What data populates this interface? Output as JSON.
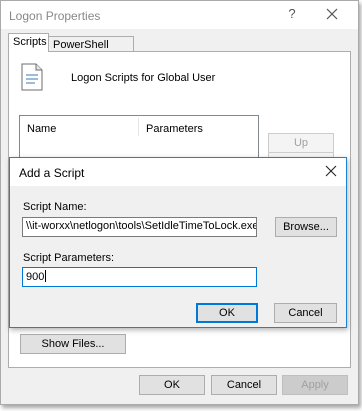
{
  "outer": {
    "title": "Logon Properties",
    "help_glyph": "?",
    "tabs": [
      {
        "label": "Scripts",
        "active": true
      },
      {
        "label": "PowerShell Scripts",
        "active": false
      }
    ],
    "panel_heading": "Logon Scripts for Global User",
    "list_columns": [
      "Name",
      "Parameters"
    ],
    "up_label": "Up",
    "show_files_label": "Show Files...",
    "ok_label": "OK",
    "cancel_label": "Cancel",
    "apply_label": "Apply"
  },
  "dialog": {
    "title": "Add a Script",
    "script_name_label": "Script Name:",
    "script_name_value": "\\\\it-worxx\\netlogon\\tools\\SetIdleTimeToLock.exe",
    "browse_label": "Browse...",
    "script_params_label": "Script Parameters:",
    "script_params_value": "900",
    "ok_label": "OK",
    "cancel_label": "Cancel"
  },
  "colors": {
    "accent": "#0078d7",
    "window_bg": "#f0f0f0",
    "disabled_text": "#a0a0a0"
  },
  "icons": [
    "close-icon",
    "help-icon",
    "script-document-icon"
  ]
}
